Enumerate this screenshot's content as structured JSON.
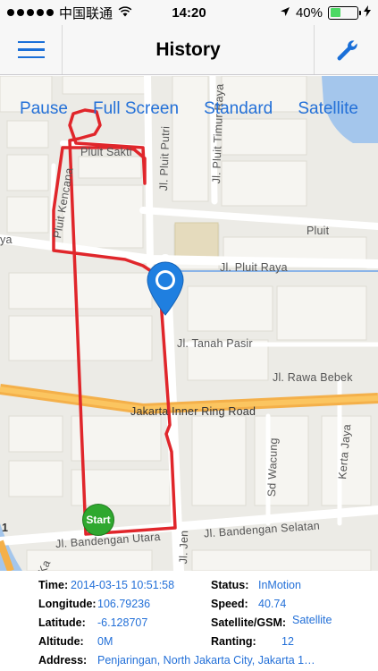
{
  "status_bar": {
    "carrier": "中国联通",
    "time": "14:20",
    "battery": "40%",
    "battery_level": 0.4
  },
  "nav": {
    "title": "History"
  },
  "map_controls": {
    "pause": "Pause",
    "full_screen": "Full Screen",
    "standard": "Standard",
    "satellite": "Satellite"
  },
  "map_labels": {
    "pluit_sakti": "Pluit Sakti",
    "pluit_kencana": "Pluit Kencana",
    "jl_pluit_putri": "Jl. Pluit Putri",
    "jl_pluit_timur_raya": "Jl. Pluit Timur Raya",
    "pluit": "Pluit",
    "ya": "ya",
    "jl_pluit_raya": "Jl. Pluit Raya",
    "jl_tanah_pasir": "Jl. Tanah Pasir",
    "jl_rawa_bebek": "Jl. Rawa Bebek",
    "jakarta_inner_ring_road": "Jakarta Inner Ring Road",
    "sd_wacung": "Sd Wacung",
    "kerta_jaya": "Kerta Jaya",
    "jl_bandengan_utara": "Jl. Bandengan Utara",
    "jl_bandengan_selatan": "Jl. Bandengan Selatan",
    "jl_jen": "Jl. Jen",
    "ka": "Ka",
    "one": "1",
    "start": "Start"
  },
  "info": {
    "time_label": "Time:",
    "time_value": "2014-03-15 10:51:58",
    "status_label": "Status:",
    "status_value": "InMotion",
    "longitude_label": "Longitude:",
    "longitude_value": "106.79236",
    "speed_label": "Speed:",
    "speed_value": "40.74",
    "latitude_label": "Latitude:",
    "latitude_value": "-6.128707",
    "satellite_label": "Satellite/GSM:",
    "satellite_value": "Satellite",
    "altitude_label": "Altitude:",
    "altitude_value": "0M",
    "ranting_label": "Ranting:",
    "ranting_value": "12",
    "address_label": "Address:",
    "address_value": "Penjaringan, North Jakarta City, Jakarta 1…"
  }
}
